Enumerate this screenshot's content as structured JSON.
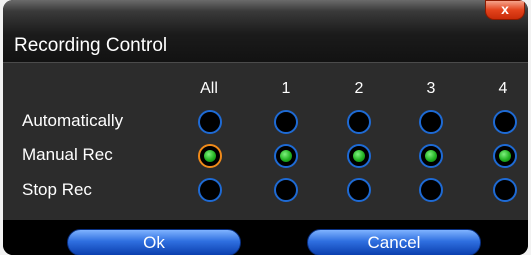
{
  "dialog": {
    "title": "Recording Control",
    "close_label": "x"
  },
  "columns": [
    "All",
    "1",
    "2",
    "3",
    "4"
  ],
  "rows": [
    {
      "label": "Automatically",
      "selected": [
        false,
        false,
        false,
        false,
        false
      ]
    },
    {
      "label": "Manual Rec",
      "selected": [
        true,
        true,
        true,
        true,
        true
      ]
    },
    {
      "label": "Stop Rec",
      "selected": [
        false,
        false,
        false,
        false,
        false
      ]
    }
  ],
  "buttons": {
    "ok_label": "Ok",
    "cancel_label": "Cancel"
  },
  "colors": {
    "radio_border": "#1e6ad4",
    "all_selected_border": "#f08a1a",
    "selected_dot": "#22b222",
    "button_blue": "#2f6fe0"
  }
}
